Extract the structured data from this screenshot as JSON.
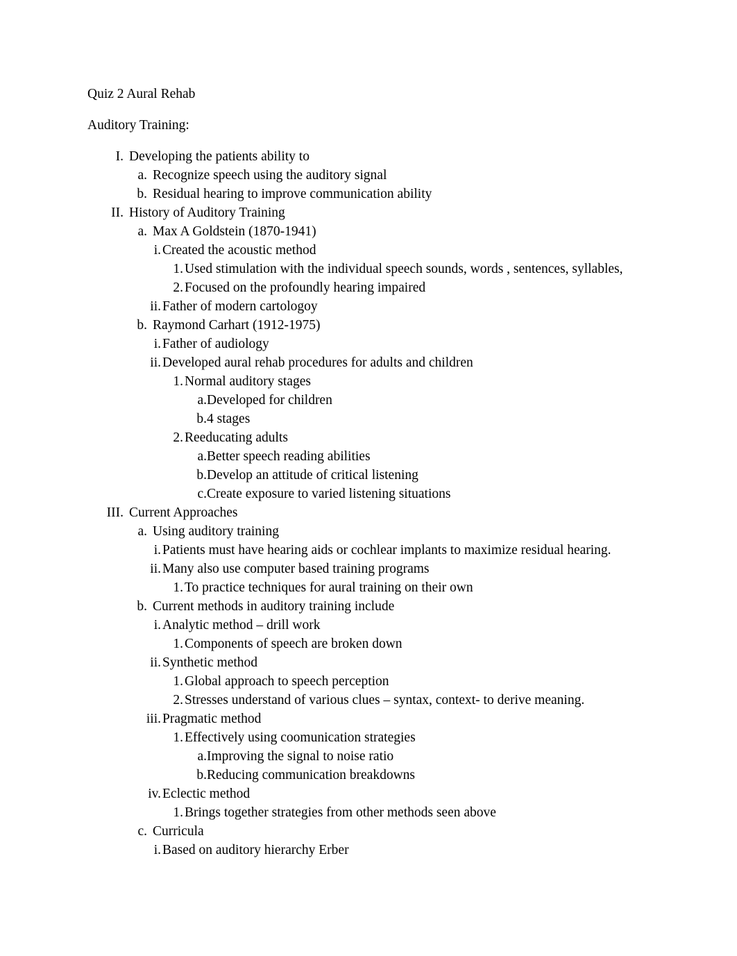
{
  "document": {
    "title_line": "Quiz 2 Aural Rehab",
    "lead_line": "Auditory Training:",
    "page_background": "#ffffff",
    "text_color": "#000000",
    "outline": [
      {
        "level": 1,
        "marker": "I.",
        "text": "Developing the patients ability to"
      },
      {
        "level": 2,
        "marker": "a.",
        "text": "Recognize speech using the auditory signal"
      },
      {
        "level": 2,
        "marker": "b.",
        "text": "Residual hearing to improve communication ability"
      },
      {
        "level": 1,
        "marker": "II.",
        "text": "History of Auditory Training"
      },
      {
        "level": 2,
        "marker": "a.",
        "text": "Max A Goldstein (1870-1941)"
      },
      {
        "level": 3,
        "marker": "i.",
        "text": "Created the acoustic method"
      },
      {
        "level": 4,
        "marker": "1.",
        "text": "Used stimulation with the individual speech sounds, words , sentences, syllables,"
      },
      {
        "level": 4,
        "marker": "2.",
        "text": "Focused on the profoundly hearing impaired"
      },
      {
        "level": 3,
        "marker": "ii.",
        "text": "Father of modern cartologoy"
      },
      {
        "level": 2,
        "marker": "b.",
        "text": "Raymond Carhart (1912-1975)"
      },
      {
        "level": 3,
        "marker": "i.",
        "text": "Father of audiology"
      },
      {
        "level": 3,
        "marker": "ii.",
        "text": "Developed aural rehab procedures for adults and children"
      },
      {
        "level": 4,
        "marker": "1.",
        "text": "Normal auditory stages"
      },
      {
        "level": 5,
        "marker": "a.",
        "text": "Developed for children"
      },
      {
        "level": 5,
        "marker": "b.",
        "text": "4 stages"
      },
      {
        "level": 4,
        "marker": "2.",
        "text": "Reeducating adults"
      },
      {
        "level": 5,
        "marker": "a.",
        "text": "Better speech reading abilities"
      },
      {
        "level": 5,
        "marker": "b.",
        "text": "Develop an attitude of critical listening"
      },
      {
        "level": 5,
        "marker": "c.",
        "text": "Create exposure to varied listening situations"
      },
      {
        "level": 1,
        "marker": "III.",
        "text": "Current Approaches"
      },
      {
        "level": 2,
        "marker": "a.",
        "text": "Using auditory training"
      },
      {
        "level": 3,
        "marker": "i.",
        "text": "Patients must have hearing aids or cochlear implants to maximize residual hearing."
      },
      {
        "level": 3,
        "marker": "ii.",
        "text": "Many also use computer based training programs"
      },
      {
        "level": 4,
        "marker": "1.",
        "text": "To practice techniques for aural training on their own"
      },
      {
        "level": 2,
        "marker": "b.",
        "text": "Current methods in auditory training include"
      },
      {
        "level": 3,
        "marker": "i.",
        "text": "Analytic method – drill work"
      },
      {
        "level": 4,
        "marker": "1.",
        "text": "Components of speech are broken down"
      },
      {
        "level": 3,
        "marker": "ii.",
        "text": "Synthetic method"
      },
      {
        "level": 4,
        "marker": "1.",
        "text": "Global approach to speech perception"
      },
      {
        "level": 4,
        "marker": "2.",
        "text": "Stresses understand of various clues – syntax, context- to derive meaning."
      },
      {
        "level": 3,
        "marker": "iii.",
        "text": "Pragmatic method"
      },
      {
        "level": 4,
        "marker": "1.",
        "text": "Effectively using coomunication strategies"
      },
      {
        "level": 5,
        "marker": "a.",
        "text": "Improving the signal to noise ratio"
      },
      {
        "level": 5,
        "marker": "b.",
        "text": "Reducing communication breakdowns"
      },
      {
        "level": 3,
        "marker": "iv.",
        "text": "Eclectic method"
      },
      {
        "level": 4,
        "marker": "1.",
        "text": "Brings together strategies from other methods seen above"
      },
      {
        "level": 2,
        "marker": "c.",
        "text": "Curricula"
      },
      {
        "level": 3,
        "marker": "i.",
        "text": "Based on auditory hierarchy Erber"
      }
    ]
  }
}
